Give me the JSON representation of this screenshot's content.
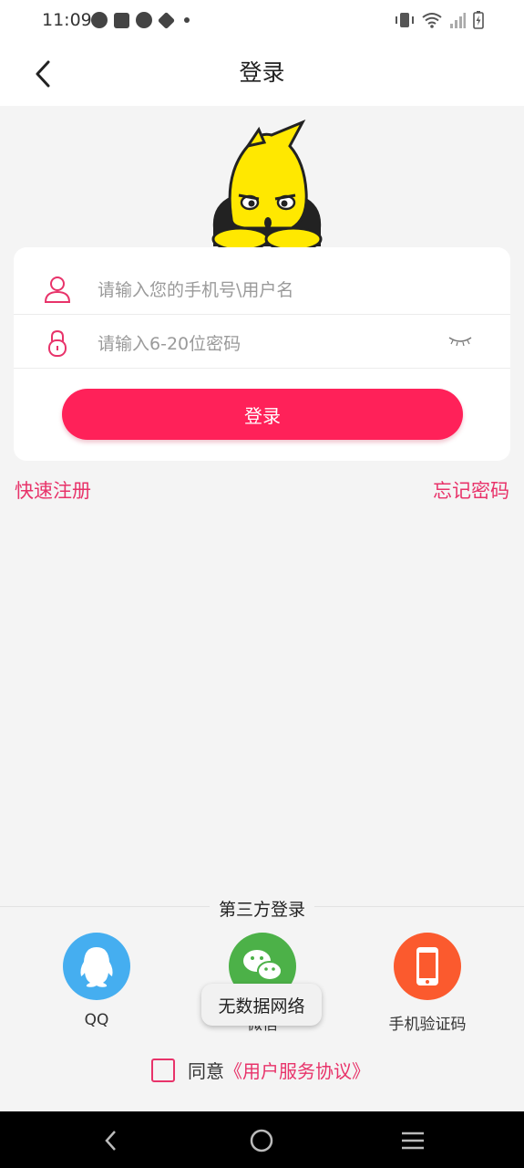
{
  "status_bar": {
    "time": "11:09",
    "left_icons": [
      "speedometer-icon",
      "bag-icon",
      "check-circle-icon",
      "stack-icon",
      "dot-icon"
    ],
    "right_icons": [
      "vibrate-icon",
      "wifi-icon",
      "signal-icon",
      "battery-charging-icon"
    ]
  },
  "header": {
    "title": "登录",
    "back_icon": "chevron-left-icon"
  },
  "login_form": {
    "username_placeholder": "请输入您的手机号\\用户名",
    "password_placeholder": "请输入6-20位密码",
    "login_button": "登录",
    "user_icon": "user-icon",
    "lock_icon": "lock-icon",
    "eye_icon": "eye-closed-icon"
  },
  "links": {
    "register": "快速注册",
    "forgot_password": "忘记密码"
  },
  "third_party": {
    "title": "第三方登录",
    "options": [
      {
        "label": "QQ",
        "icon": "qq-icon",
        "color": "#45aef0"
      },
      {
        "label": "微信",
        "icon": "wechat-icon",
        "color": "#4cb148"
      },
      {
        "label": "手机验证码",
        "icon": "phone-icon",
        "color": "#fb5a2e"
      }
    ]
  },
  "toast": "无数据网络",
  "agreement": {
    "prefix": "同意",
    "link": "《用户服务协议》"
  },
  "colors": {
    "accent": "#ff2159",
    "link": "#e8336a",
    "background": "#f4f4f4"
  }
}
